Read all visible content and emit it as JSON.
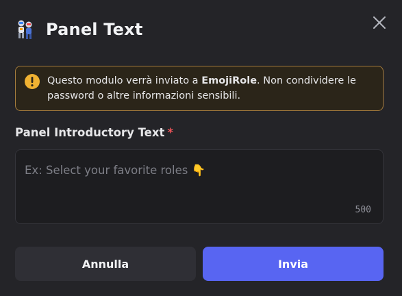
{
  "modal": {
    "title": "Panel Text",
    "bot_avatar_icon": "robot-avatar-icon",
    "close_icon": "close-icon"
  },
  "warning": {
    "icon": "exclamation-circle-icon",
    "text_before": "Questo modulo verrà inviato a ",
    "app_name": "EmojiRole",
    "text_after": ". Non condividere le password o altre informazioni sensibili.",
    "border_color": "#a57c3d",
    "icon_color": "#f0b232"
  },
  "field": {
    "label": "Panel Introductory Text",
    "required_mark": "*",
    "placeholder": "Ex: Select your favorite roles 👇",
    "counter": "500"
  },
  "buttons": {
    "cancel_label": "Annulla",
    "submit_label": "Invia",
    "submit_color": "#5865f2"
  }
}
